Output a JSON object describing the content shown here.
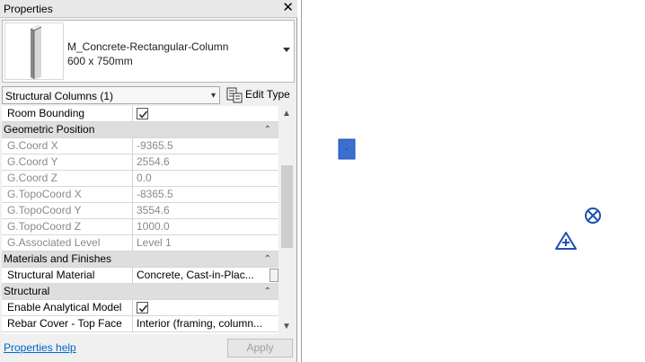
{
  "panel": {
    "title": "Properties",
    "close_glyph": "✕",
    "type_name": "M_Concrete-Rectangular-Column",
    "type_size": "600 x 750mm",
    "filter_label": "Structural Columns (1)",
    "edit_type_label": "Edit Type",
    "help_link": "Properties help",
    "apply_label": "Apply"
  },
  "rows": [
    {
      "name": "Room Bounding",
      "value": "",
      "checkbox": true
    },
    {
      "group": "Geometric Position"
    },
    {
      "name": "G.Coord X",
      "value": "-9365.5",
      "readonly": true
    },
    {
      "name": "G.Coord Y",
      "value": "2554.6",
      "readonly": true
    },
    {
      "name": "G.Coord Z",
      "value": "0.0",
      "readonly": true
    },
    {
      "name": "G.TopoCoord X",
      "value": "-8365.5",
      "readonly": true
    },
    {
      "name": "G.TopoCoord Y",
      "value": "3554.6",
      "readonly": true
    },
    {
      "name": "G.TopoCoord Z",
      "value": "1000.0",
      "readonly": true
    },
    {
      "name": "G.Associated Level",
      "value": "Level 1",
      "readonly": true
    },
    {
      "group": "Materials and Finishes"
    },
    {
      "name": "Structural Material",
      "value": "Concrete, Cast-in-Plac...",
      "button": true
    },
    {
      "group": "Structural"
    },
    {
      "name": "Enable Analytical Model",
      "value": "",
      "checkbox": true
    },
    {
      "name": "Rebar Cover - Top Face",
      "value": "Interior (framing, column..."
    }
  ],
  "colors": {
    "column_fill": "#3a6fd0",
    "marker_stroke": "#2050b0"
  }
}
